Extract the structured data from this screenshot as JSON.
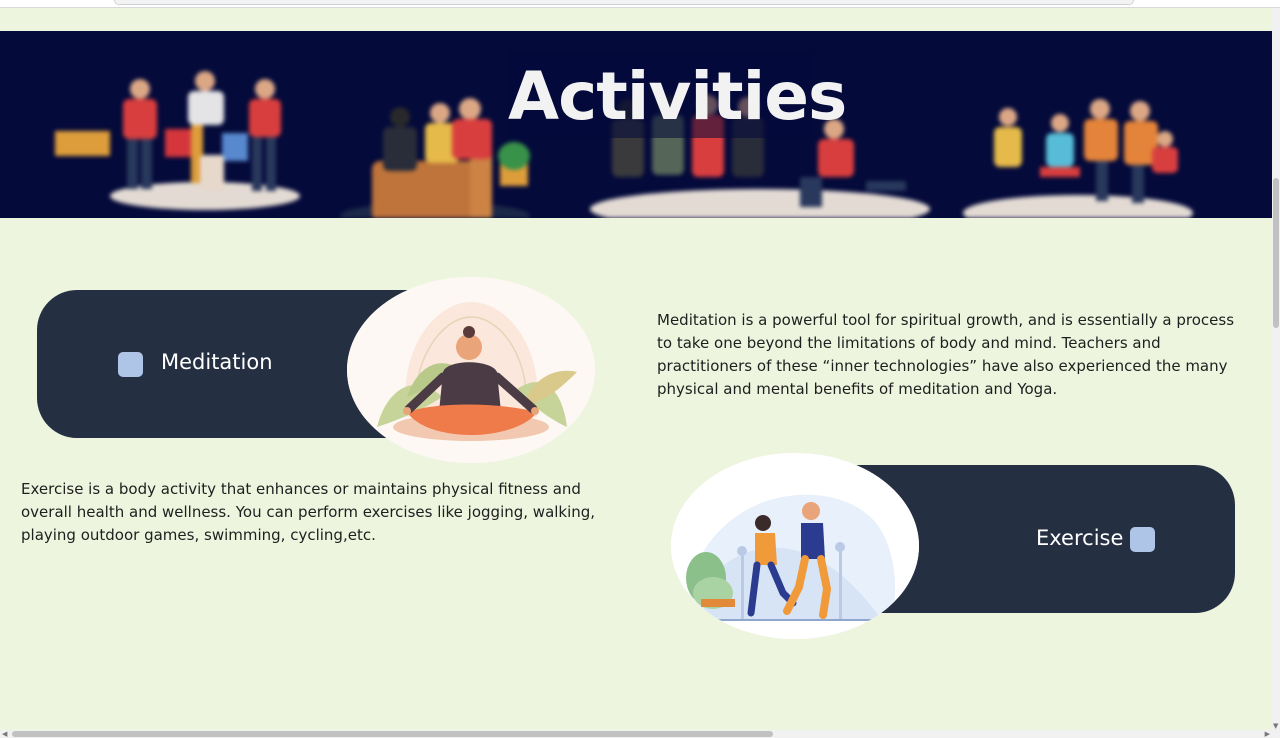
{
  "banner": {
    "title": "Activities"
  },
  "cards": [
    {
      "label": "Meditation",
      "description": "Meditation is a powerful tool for spiritual growth, and is essentially a process to take one beyond the limitations of body and mind. Teachers and practitioners of these “inner technologies” have also experienced the many physical and mental benefits of meditation and Yoga."
    },
    {
      "label": "Exercise",
      "description": "Exercise is a body activity that enhances or maintains physical fitness and overall health and wellness. You can perform exercises like jogging, walking, playing outdoor games, swimming, cycling,etc."
    }
  ],
  "colors": {
    "page_bg": "#eef5df",
    "banner_bg": "#040a3a",
    "pill_bg": "#252f42",
    "square_accent": "#aec5e8"
  },
  "icons": {
    "card_marker": "square-marker-icon",
    "scroll_left": "arrow-left-icon",
    "scroll_right": "arrow-right-icon",
    "scroll_down": "arrow-down-icon"
  }
}
